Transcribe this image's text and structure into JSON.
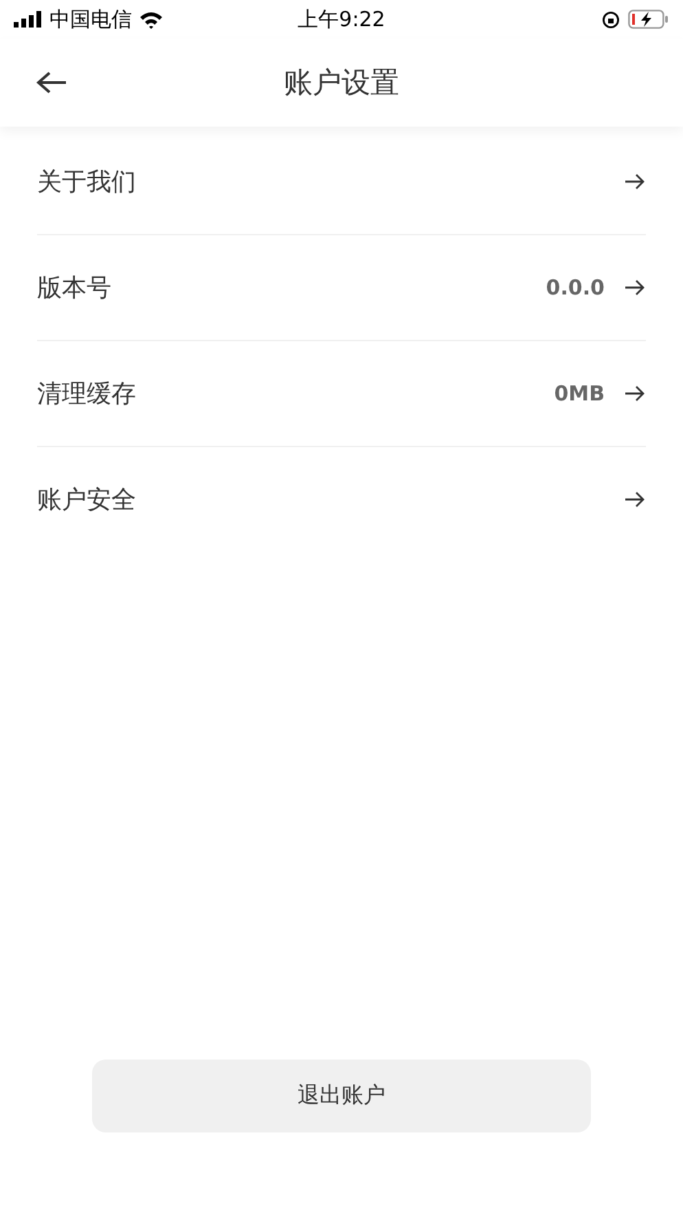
{
  "status_bar": {
    "carrier": "中国电信",
    "time": "上午9:22"
  },
  "header": {
    "title": "账户设置"
  },
  "items": [
    {
      "label": "关于我们"
    },
    {
      "label": "版本号",
      "value": "0.0.0"
    },
    {
      "label": "清理缓存",
      "value": "0MB"
    },
    {
      "label": "账户安全"
    }
  ],
  "logout_button": "退出账户"
}
